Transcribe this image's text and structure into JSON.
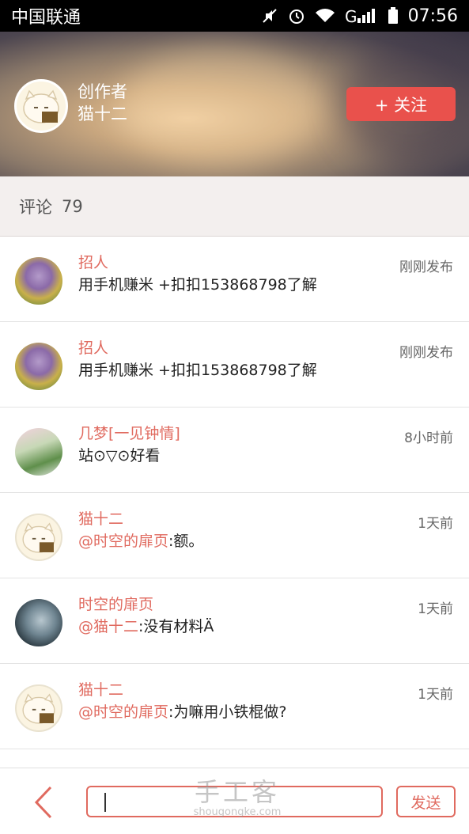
{
  "status_bar": {
    "carrier": "中国联通",
    "time": "07:56",
    "icons": [
      "mute-icon",
      "alarm-icon",
      "wifi-icon",
      "signal-icon",
      "battery-icon"
    ]
  },
  "header": {
    "author_label": "创作者",
    "author_name": "猫十二",
    "follow_label": "+ 关注"
  },
  "comments_header": {
    "label": "评论",
    "count": "79"
  },
  "comments": [
    {
      "user": "招人",
      "mention": "",
      "text": "用手机赚米 +扣扣153868798了解",
      "time": "刚刚发布"
    },
    {
      "user": "招人",
      "mention": "",
      "text": "用手机赚米 +扣扣153868798了解",
      "time": "刚刚发布"
    },
    {
      "user": "几梦[一见钟情]",
      "mention": "",
      "text": "站⊙▽⊙好看",
      "time": "8小时前"
    },
    {
      "user": "猫十二",
      "mention": "@时空的扉页",
      "text": ":额。",
      "time": "1天前"
    },
    {
      "user": "时空的扉页",
      "mention": "@猫十二",
      "text": ":没有材料Ä",
      "time": "1天前"
    },
    {
      "user": "猫十二",
      "mention": "@时空的扉页",
      "text": ":为嘛用小铁棍做?",
      "time": "1天前"
    }
  ],
  "bottom_bar": {
    "input_value": "",
    "send_label": "发送"
  },
  "watermark": {
    "main": "手工客",
    "sub": "shougongke.com"
  },
  "colors": {
    "accent": "#e9514c",
    "username": "#e06a5f"
  }
}
